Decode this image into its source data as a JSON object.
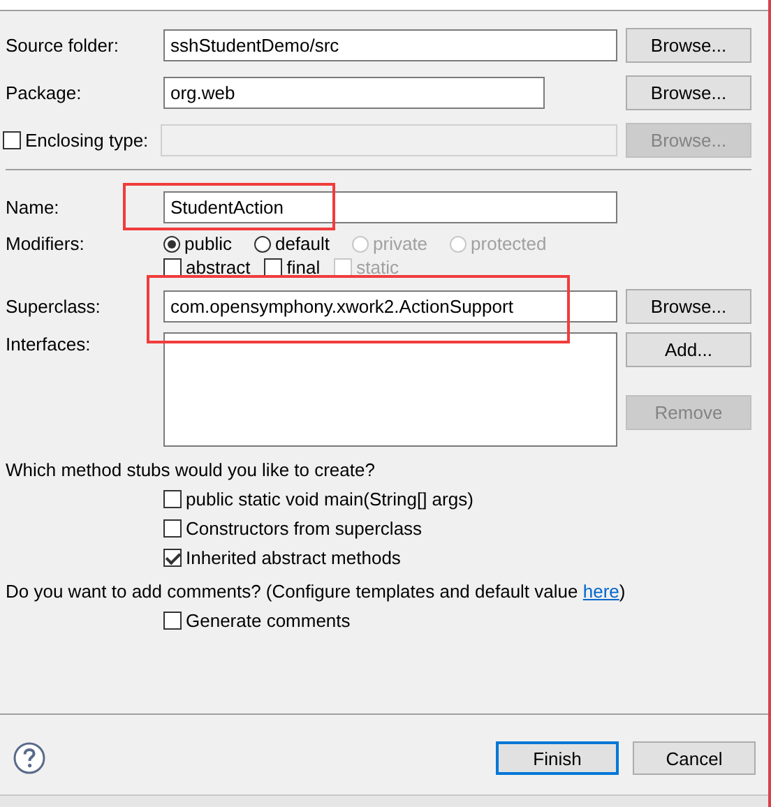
{
  "source_folder": {
    "label": "Source folder:",
    "value": "sshStudentDemo/src",
    "button": "Browse..."
  },
  "package": {
    "label": "Package:",
    "value": "org.web",
    "button": "Browse..."
  },
  "enclosing_type": {
    "label": "Enclosing type:",
    "checked": false,
    "disabled": true,
    "button": "Browse..."
  },
  "name": {
    "label": "Name:",
    "value": "StudentAction",
    "highlighted": true
  },
  "modifiers": {
    "label": "Modifiers:",
    "access": [
      {
        "label": "public",
        "selected": true,
        "disabled": false
      },
      {
        "label": "default",
        "selected": false,
        "disabled": false
      },
      {
        "label": "private",
        "selected": false,
        "disabled": true
      },
      {
        "label": "protected",
        "selected": false,
        "disabled": true
      }
    ],
    "flags": [
      {
        "label": "abstract",
        "checked": false,
        "disabled": false
      },
      {
        "label": "final",
        "checked": false,
        "disabled": false
      },
      {
        "label": "static",
        "checked": false,
        "disabled": true
      }
    ]
  },
  "superclass": {
    "label": "Superclass:",
    "value": "com.opensymphony.xwork2.ActionSupport",
    "button": "Browse...",
    "highlighted": true
  },
  "interfaces": {
    "label": "Interfaces:",
    "buttons": [
      {
        "label": "Add...",
        "disabled": false
      },
      {
        "label": "Remove",
        "disabled": true
      }
    ]
  },
  "stubs": {
    "question": "Which method stubs would you like to create?",
    "options": [
      {
        "label": "public static void main(String[] args)",
        "checked": false
      },
      {
        "label": "Constructors from superclass",
        "checked": false
      },
      {
        "label": "Inherited abstract methods",
        "checked": true
      }
    ]
  },
  "comments": {
    "question": "Do you want to add comments? (Configure templates and default value ",
    "link": "here",
    "question_end": ")",
    "options": [
      {
        "label": "Generate comments",
        "checked": false
      }
    ]
  },
  "footer": {
    "buttons": [
      {
        "label": "Finish",
        "default": true
      },
      {
        "label": "Cancel",
        "default": false
      }
    ]
  }
}
